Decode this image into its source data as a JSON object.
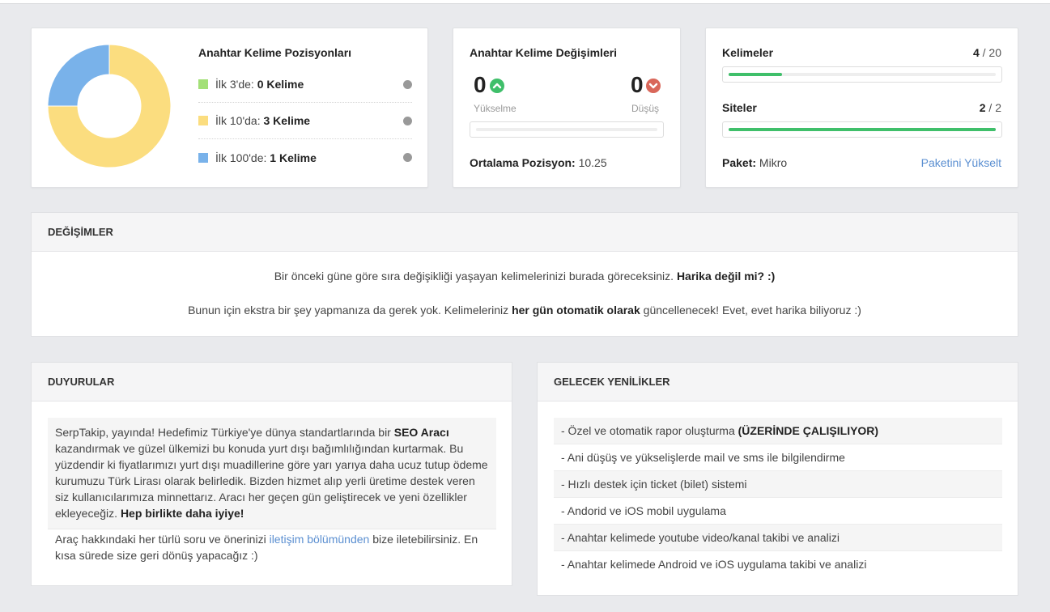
{
  "positions": {
    "title": "Anahtar Kelime Pozisyonları",
    "rows": [
      {
        "prefix": "İlk 3'de: ",
        "value": "0 Kelime",
        "count": 0,
        "color": "#a3e077"
      },
      {
        "prefix": "İlk 10'da: ",
        "value": "3 Kelime",
        "count": 3,
        "color": "#fbdd7f"
      },
      {
        "prefix": "İlk 100'de: ",
        "value": "1 Kelime",
        "count": 1,
        "color": "#79b2ea"
      }
    ]
  },
  "changes": {
    "title": "Anahtar Kelime Değişimleri",
    "up_count": "0",
    "up_label": "Yükselme",
    "down_count": "0",
    "down_label": "Düşüş",
    "progress": 0,
    "avg_label": "Ortalama Pozisyon:",
    "avg_value": "10.25"
  },
  "usage": {
    "words_label": "Kelimeler",
    "words_used": "4",
    "words_total": " / 20",
    "words_fraction": 0.2,
    "sites_label": "Siteler",
    "sites_used": "2",
    "sites_total": " / 2",
    "sites_fraction": 1.0,
    "package_label": "Paket:",
    "package_value": "Mikro",
    "upgrade_link": "Paketini Yükselt"
  },
  "degisimler": {
    "title": "DEĞİŞİMLER",
    "line1_text": "Bir önceki güne göre sıra değişikliği yaşayan kelimelerinizi burada göreceksiniz. ",
    "line1_bold": "Harika değil mi? :)",
    "line2_text": "Bunun için ekstra bir şey yapmanıza da gerek yok. Kelimeleriniz ",
    "line2_bold": "her gün otomatik olarak",
    "line2_end": " güncellenecek! Evet, evet harika biliyoruz :)"
  },
  "duyurular": {
    "title": "DUYURULAR",
    "p1_a": "SerpTakip, yayında! Hedefimiz Türkiye'ye dünya standartlarında bir ",
    "p1_b": "SEO Aracı",
    "p1_c": " kazandırmak ve güzel ülkemizi bu konuda yurt dışı bağımlılığından kurtarmak. Bu yüzdendir ki fiyatlarımızı yurt dışı muadillerine göre yarı yarıya daha ucuz tutup ödeme kurumuzu Türk Lirası olarak belirledik. Bizden hizmet alıp yerli üretime destek veren siz kullanıcılarımıza minnettarız. Aracı her geçen gün geliştirecek ve yeni özellikler ekleyeceğiz. ",
    "p1_d": "Hep birlikte daha iyiye!",
    "p2_a": "Araç hakkındaki her türlü soru ve önerinizi ",
    "p2_link": "iletişim bölümünden",
    "p2_b": " bize iletebilirsiniz. En kısa sürede size geri dönüş yapacağız :)"
  },
  "gelecek": {
    "title": "GELECEK YENİLİKLER",
    "items": [
      {
        "text": "- Özel ve otomatik rapor oluşturma ",
        "bold": "(ÜZERİNDE ÇALIŞILIYOR)"
      },
      {
        "text": "- Ani düşüş ve yükselişlerde mail ve sms ile bilgilendirme",
        "bold": ""
      },
      {
        "text": "- Hızlı destek için ticket (bilet) sistemi",
        "bold": ""
      },
      {
        "text": "- Andorid ve iOS mobil uygulama",
        "bold": ""
      },
      {
        "text": "- Anahtar kelimede youtube video/kanal takibi ve analizi",
        "bold": ""
      },
      {
        "text": "- Anahtar kelimede Android ve iOS uygulama takibi ve analizi",
        "bold": ""
      }
    ]
  }
}
